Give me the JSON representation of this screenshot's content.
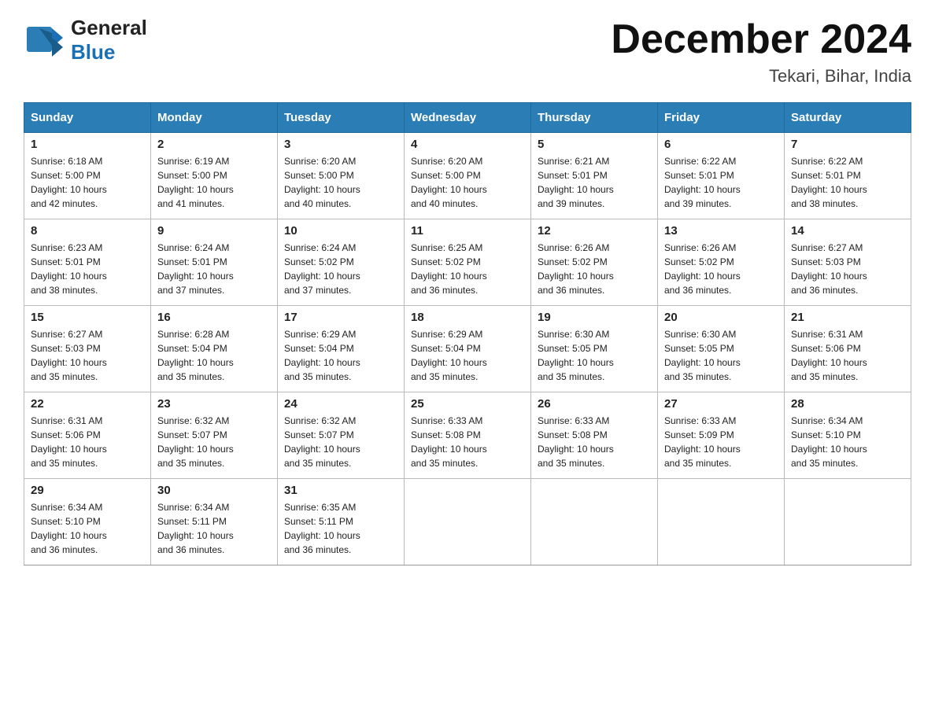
{
  "header": {
    "title": "December 2024",
    "subtitle": "Tekari, Bihar, India",
    "logo_line1": "General",
    "logo_line2": "Blue"
  },
  "days_of_week": [
    "Sunday",
    "Monday",
    "Tuesday",
    "Wednesday",
    "Thursday",
    "Friday",
    "Saturday"
  ],
  "weeks": [
    [
      {
        "day": "1",
        "sunrise": "6:18 AM",
        "sunset": "5:00 PM",
        "daylight": "10 hours and 42 minutes."
      },
      {
        "day": "2",
        "sunrise": "6:19 AM",
        "sunset": "5:00 PM",
        "daylight": "10 hours and 41 minutes."
      },
      {
        "day": "3",
        "sunrise": "6:20 AM",
        "sunset": "5:00 PM",
        "daylight": "10 hours and 40 minutes."
      },
      {
        "day": "4",
        "sunrise": "6:20 AM",
        "sunset": "5:00 PM",
        "daylight": "10 hours and 40 minutes."
      },
      {
        "day": "5",
        "sunrise": "6:21 AM",
        "sunset": "5:01 PM",
        "daylight": "10 hours and 39 minutes."
      },
      {
        "day": "6",
        "sunrise": "6:22 AM",
        "sunset": "5:01 PM",
        "daylight": "10 hours and 39 minutes."
      },
      {
        "day": "7",
        "sunrise": "6:22 AM",
        "sunset": "5:01 PM",
        "daylight": "10 hours and 38 minutes."
      }
    ],
    [
      {
        "day": "8",
        "sunrise": "6:23 AM",
        "sunset": "5:01 PM",
        "daylight": "10 hours and 38 minutes."
      },
      {
        "day": "9",
        "sunrise": "6:24 AM",
        "sunset": "5:01 PM",
        "daylight": "10 hours and 37 minutes."
      },
      {
        "day": "10",
        "sunrise": "6:24 AM",
        "sunset": "5:02 PM",
        "daylight": "10 hours and 37 minutes."
      },
      {
        "day": "11",
        "sunrise": "6:25 AM",
        "sunset": "5:02 PM",
        "daylight": "10 hours and 36 minutes."
      },
      {
        "day": "12",
        "sunrise": "6:26 AM",
        "sunset": "5:02 PM",
        "daylight": "10 hours and 36 minutes."
      },
      {
        "day": "13",
        "sunrise": "6:26 AM",
        "sunset": "5:02 PM",
        "daylight": "10 hours and 36 minutes."
      },
      {
        "day": "14",
        "sunrise": "6:27 AM",
        "sunset": "5:03 PM",
        "daylight": "10 hours and 36 minutes."
      }
    ],
    [
      {
        "day": "15",
        "sunrise": "6:27 AM",
        "sunset": "5:03 PM",
        "daylight": "10 hours and 35 minutes."
      },
      {
        "day": "16",
        "sunrise": "6:28 AM",
        "sunset": "5:04 PM",
        "daylight": "10 hours and 35 minutes."
      },
      {
        "day": "17",
        "sunrise": "6:29 AM",
        "sunset": "5:04 PM",
        "daylight": "10 hours and 35 minutes."
      },
      {
        "day": "18",
        "sunrise": "6:29 AM",
        "sunset": "5:04 PM",
        "daylight": "10 hours and 35 minutes."
      },
      {
        "day": "19",
        "sunrise": "6:30 AM",
        "sunset": "5:05 PM",
        "daylight": "10 hours and 35 minutes."
      },
      {
        "day": "20",
        "sunrise": "6:30 AM",
        "sunset": "5:05 PM",
        "daylight": "10 hours and 35 minutes."
      },
      {
        "day": "21",
        "sunrise": "6:31 AM",
        "sunset": "5:06 PM",
        "daylight": "10 hours and 35 minutes."
      }
    ],
    [
      {
        "day": "22",
        "sunrise": "6:31 AM",
        "sunset": "5:06 PM",
        "daylight": "10 hours and 35 minutes."
      },
      {
        "day": "23",
        "sunrise": "6:32 AM",
        "sunset": "5:07 PM",
        "daylight": "10 hours and 35 minutes."
      },
      {
        "day": "24",
        "sunrise": "6:32 AM",
        "sunset": "5:07 PM",
        "daylight": "10 hours and 35 minutes."
      },
      {
        "day": "25",
        "sunrise": "6:33 AM",
        "sunset": "5:08 PM",
        "daylight": "10 hours and 35 minutes."
      },
      {
        "day": "26",
        "sunrise": "6:33 AM",
        "sunset": "5:08 PM",
        "daylight": "10 hours and 35 minutes."
      },
      {
        "day": "27",
        "sunrise": "6:33 AM",
        "sunset": "5:09 PM",
        "daylight": "10 hours and 35 minutes."
      },
      {
        "day": "28",
        "sunrise": "6:34 AM",
        "sunset": "5:10 PM",
        "daylight": "10 hours and 35 minutes."
      }
    ],
    [
      {
        "day": "29",
        "sunrise": "6:34 AM",
        "sunset": "5:10 PM",
        "daylight": "10 hours and 36 minutes."
      },
      {
        "day": "30",
        "sunrise": "6:34 AM",
        "sunset": "5:11 PM",
        "daylight": "10 hours and 36 minutes."
      },
      {
        "day": "31",
        "sunrise": "6:35 AM",
        "sunset": "5:11 PM",
        "daylight": "10 hours and 36 minutes."
      },
      {
        "day": "",
        "sunrise": "",
        "sunset": "",
        "daylight": ""
      },
      {
        "day": "",
        "sunrise": "",
        "sunset": "",
        "daylight": ""
      },
      {
        "day": "",
        "sunrise": "",
        "sunset": "",
        "daylight": ""
      },
      {
        "day": "",
        "sunrise": "",
        "sunset": "",
        "daylight": ""
      }
    ]
  ],
  "labels": {
    "sunrise": "Sunrise:",
    "sunset": "Sunset:",
    "daylight": "Daylight:"
  }
}
